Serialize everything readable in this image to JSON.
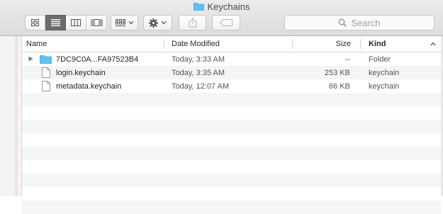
{
  "window": {
    "title": "Keychains"
  },
  "toolbar": {
    "view_modes": [
      "icon-view",
      "list-view",
      "column-view",
      "cover-flow-view"
    ],
    "active_view": "list-view",
    "search_placeholder": "Search"
  },
  "columns": {
    "name": "Name",
    "date_modified": "Date Modified",
    "size": "Size",
    "kind": "Kind"
  },
  "files": [
    {
      "name": "7DC9C0A...FA97523B4",
      "date": "Today, 3:33 AM",
      "size": "--",
      "kind": "Folder",
      "type": "folder",
      "expandable": true
    },
    {
      "name": "login.keychain",
      "date": "Today, 3:35 AM",
      "size": "253 KB",
      "kind": "keychain",
      "type": "file",
      "expandable": false
    },
    {
      "name": "metadata.keychain",
      "date": "Today, 12:07 AM",
      "size": "66 KB",
      "kind": "keychain",
      "type": "file",
      "expandable": false
    }
  ],
  "colors": {
    "folder": "#5ec2f2",
    "active_segment": "#6b6b6b",
    "stripe": "#f3f5f7"
  }
}
